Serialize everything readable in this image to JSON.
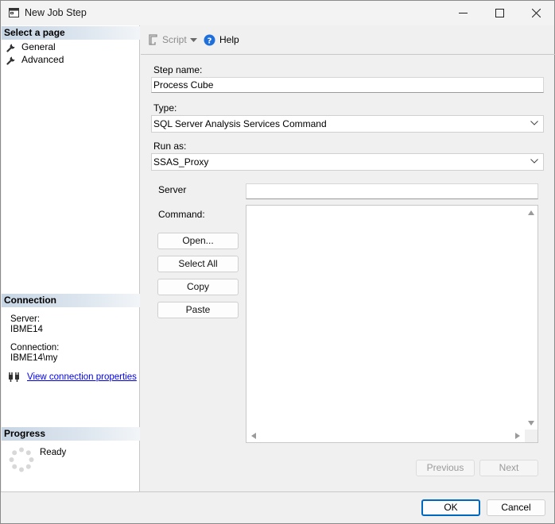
{
  "window": {
    "title": "New Job Step",
    "icon": "window-app-icon",
    "controls": [
      "minimize-icon",
      "maximize-icon",
      "close-icon"
    ]
  },
  "left_pane": {
    "select_page_header": "Select a page",
    "pages": [
      {
        "label": "General",
        "icon": "wrench-icon"
      },
      {
        "label": "Advanced",
        "icon": "wrench-icon"
      }
    ],
    "connection_header": "Connection",
    "server_label": "Server:",
    "server_value": "IBME14",
    "connection_label": "Connection:",
    "connection_value": "IBME14\\my",
    "view_connection_link": "View connection properties",
    "progress_header": "Progress",
    "progress_status": "Ready"
  },
  "toolbar": {
    "script_label": "Script",
    "help_label": "Help"
  },
  "form": {
    "step_name_label": "Step name:",
    "step_name_value": "Process Cube",
    "type_label": "Type:",
    "type_value": "SQL Server Analysis Services Command",
    "run_as_label": "Run as:",
    "run_as_value": "SSAS_Proxy",
    "server_label": "Server",
    "server_value": "",
    "command_label": "Command:",
    "command_value": "",
    "open_button": "Open...",
    "select_all_button": "Select All",
    "copy_button": "Copy",
    "paste_button": "Paste"
  },
  "navigation": {
    "previous_button": "Previous",
    "next_button": "Next"
  },
  "dialog_buttons": {
    "ok": "OK",
    "cancel": "Cancel"
  },
  "colors": {
    "accent": "#0067c0",
    "link": "#0000ee",
    "help_icon": "#1e6fd9",
    "section_header": "#c7d5e4",
    "disabled_text": "#9a9a9a"
  }
}
